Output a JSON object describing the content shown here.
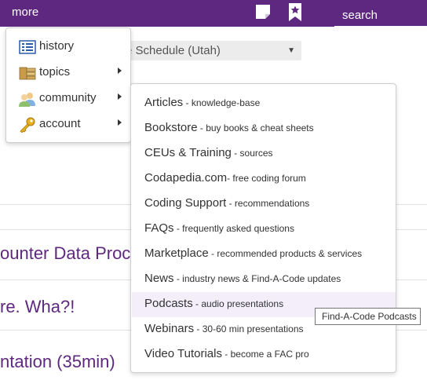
{
  "topbar": {
    "more_label": "more",
    "note_icon": "note-icon",
    "bookmark_icon": "bookmark-icon",
    "search_placeholder": "search",
    "bg_color": "#5f2880"
  },
  "background": {
    "select_value": "e Schedule (Utah)",
    "lines": [
      "ounter Data Proc",
      "re. Wha?!",
      "ntation (35min)"
    ]
  },
  "more_menu": {
    "items": [
      {
        "label": "history",
        "icon": "list-icon",
        "has_submenu": false
      },
      {
        "label": "topics",
        "icon": "books-icon",
        "has_submenu": true
      },
      {
        "label": "community",
        "icon": "people-icon",
        "has_submenu": true
      },
      {
        "label": "account",
        "icon": "key-icon",
        "has_submenu": true
      }
    ]
  },
  "topics_menu": {
    "items": [
      {
        "title": "Articles",
        "desc": " - knowledge-base"
      },
      {
        "title": "Bookstore",
        "desc": " - buy books & cheat sheets"
      },
      {
        "title": "CEUs & Training",
        "desc": " - sources"
      },
      {
        "title": "Codapedia.com",
        "desc": "- free coding forum"
      },
      {
        "title": "Coding Support",
        "desc": " - recommendations"
      },
      {
        "title": "FAQs",
        "desc": " - frequently asked questions"
      },
      {
        "title": "Marketplace",
        "desc": " - recommended products & services"
      },
      {
        "title": "News",
        "desc": " - industry news & Find-A-Code updates"
      },
      {
        "title": "Podcasts",
        "desc": " - audio presentations"
      },
      {
        "title": "Webinars",
        "desc": " - 30-60 min presentations"
      },
      {
        "title": "Video Tutorials",
        "desc": " - become a FAC pro"
      }
    ],
    "highlighted_index": 8,
    "highlight_color": "#f3eefa"
  },
  "tooltip": {
    "text": "Find-A-Code Podcasts"
  }
}
